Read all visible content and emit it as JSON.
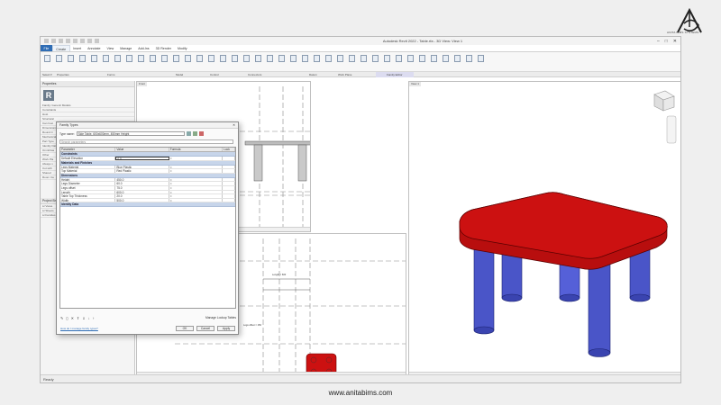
{
  "brand": {
    "logo_text": "ANITA BIMS SYSTEMS",
    "watermark": "www.anitabims.com"
  },
  "app": {
    "title": "Autodesk Revit 2022 - Table.rfa - 3D View: View 1",
    "status": "Ready"
  },
  "ribbon_tabs": [
    "File",
    "Create",
    "Insert",
    "Annotate",
    "View",
    "Manage",
    "Add-Ins",
    "3D Render",
    "Modify"
  ],
  "ribbon_groups": [
    "Select ▾",
    "Properties",
    "Forms",
    "Model",
    "Control",
    "Connectors",
    "Datum",
    "Work Plane",
    "Family Editor"
  ],
  "properties": {
    "header": "Properties",
    "family": "Family: Generic Models",
    "edit_type": "Edit Type",
    "rows": [
      "Constraints",
      "Host",
      "Structural",
      "Can host",
      "Dimensions",
      "Round C",
      "Mechanical",
      "Part Type",
      "Identity Dat",
      "OmniClas",
      "Other",
      "Work Pla",
      "Always v",
      "Cut with",
      "Shared",
      "Room Ca"
    ]
  },
  "project_browser": {
    "header": "Project Br"
  },
  "views": {
    "front": "Front",
    "plan": "Ref. Level",
    "view3d": "View 1"
  },
  "dimensions": {
    "top": "Length = 600",
    "side": "Legs offset = 150"
  },
  "dialog": {
    "title": "Family Types",
    "type_name_label": "Type name:",
    "type_name": "Side Table, 600x600mm, 450mm Height",
    "search": "Search parameters",
    "columns": [
      "Parameter",
      "Value",
      "Formula",
      "Lock"
    ],
    "groups": [
      {
        "name": "Constraints",
        "rows": [
          [
            "Default Elevation",
            "0.0",
            "=",
            ""
          ]
        ]
      },
      {
        "name": "Materials and Finishes",
        "rows": [
          [
            "Legs Material",
            "Blue Plastic",
            "=",
            ""
          ],
          [
            "Top Material",
            "Red Plastic",
            "=",
            ""
          ]
        ]
      },
      {
        "name": "Dimensions",
        "rows": [
          [
            "Height",
            "450.0",
            "=",
            ""
          ],
          [
            "Legs Diameter",
            "60.0",
            "=",
            ""
          ],
          [
            "Legs offset",
            "75.0",
            "=",
            ""
          ],
          [
            "Length",
            "600.0",
            "=",
            ""
          ],
          [
            "Table Top Thickness",
            "20.0",
            "=",
            ""
          ],
          [
            "Width",
            "500.0",
            "=",
            ""
          ]
        ]
      },
      {
        "name": "Identity Data",
        "rows": []
      }
    ],
    "manage_lookup": "Manage Lookup Tables",
    "help_link": "How do I manage family types?",
    "ok": "OK",
    "cancel": "Cancel",
    "apply": "Apply"
  },
  "colors": {
    "top": "#cc1111",
    "legs": "#4a55c8",
    "accent": "#2f6db5"
  }
}
